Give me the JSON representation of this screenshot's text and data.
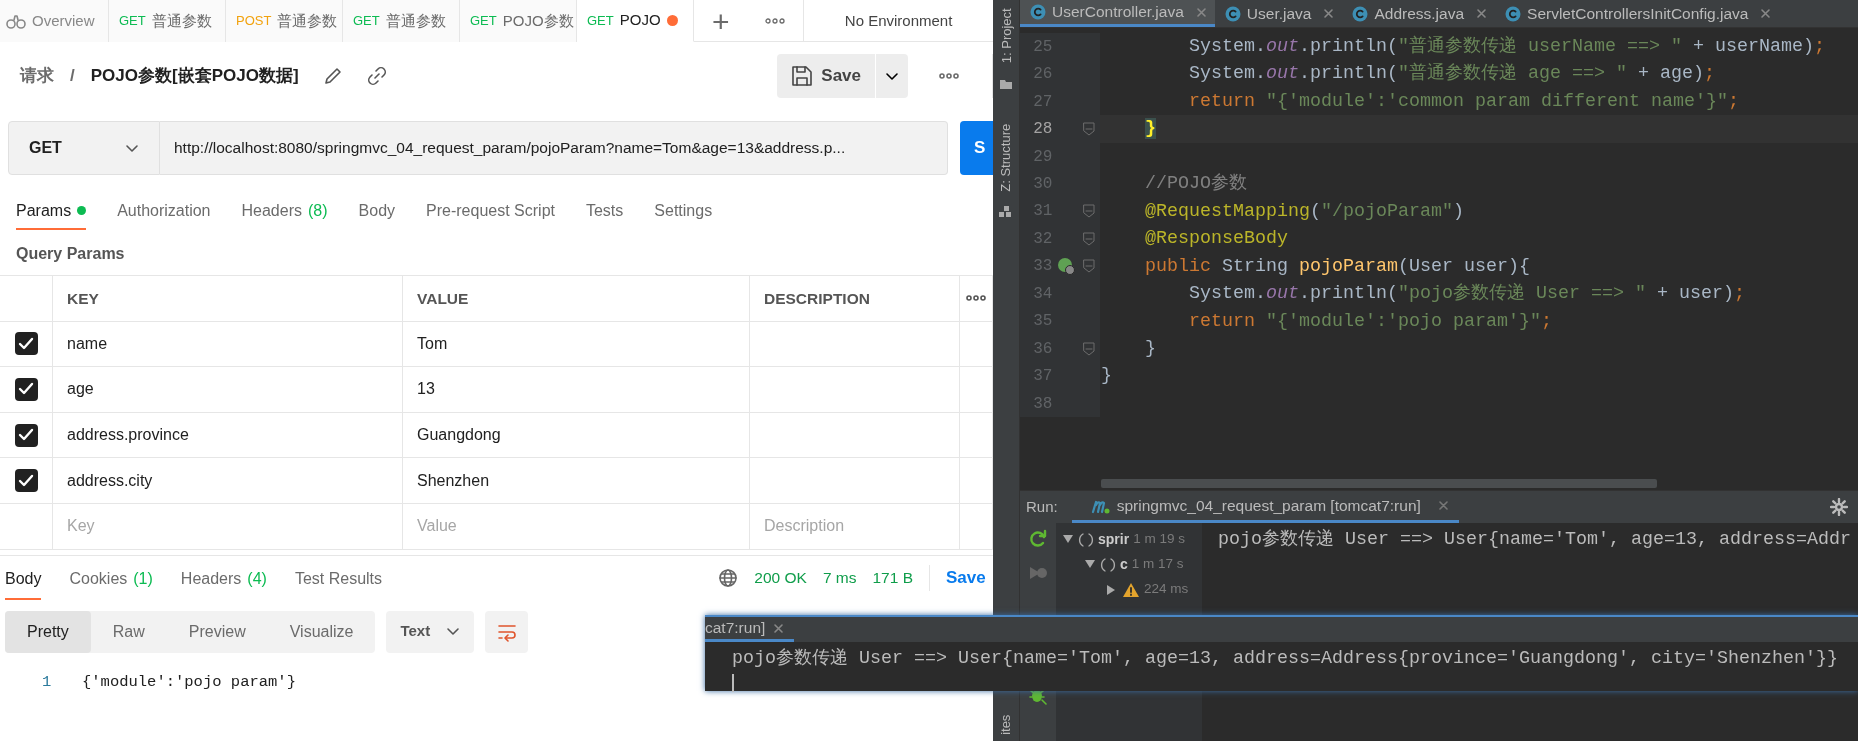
{
  "postman": {
    "tabs": [
      {
        "kind": "overview",
        "label": "Overview",
        "selected": false,
        "unsaved": false
      },
      {
        "kind": "request",
        "method": "GET",
        "label": "普通参数",
        "selected": false,
        "unsaved": false
      },
      {
        "kind": "request",
        "method": "POST",
        "label": "普通参数",
        "selected": false,
        "unsaved": false
      },
      {
        "kind": "request",
        "method": "GET",
        "label": "普通参数",
        "selected": false,
        "unsaved": false
      },
      {
        "kind": "request",
        "method": "GET",
        "label": "POJO参数",
        "selected": false,
        "unsaved": false
      },
      {
        "kind": "request",
        "method": "GET",
        "label": "POJO",
        "selected": true,
        "unsaved": true
      }
    ],
    "add_tab": "+",
    "environment": "No Environment",
    "breadcrumb": {
      "parent": "请求",
      "separator": "/",
      "title": "POJO参数[嵌套POJO数据]"
    },
    "save": "Save",
    "request": {
      "method": "GET",
      "url": "http://localhost:8080/springmvc_04_request_param/pojoParam?name=Tom&age=13&address.p...",
      "send": "S"
    },
    "request_tabs": [
      {
        "label": "Params",
        "dot": true,
        "selected": true
      },
      {
        "label": "Authorization",
        "dot": false,
        "selected": false
      },
      {
        "label": "Headers",
        "count": "(8)",
        "dot": false,
        "selected": false
      },
      {
        "label": "Body",
        "dot": false,
        "selected": false
      },
      {
        "label": "Pre-request Script",
        "dot": false,
        "selected": false
      },
      {
        "label": "Tests",
        "dot": false,
        "selected": false
      },
      {
        "label": "Settings",
        "dot": false,
        "selected": false
      }
    ],
    "query_params": {
      "title": "Query Params",
      "columns": [
        "KEY",
        "VALUE",
        "DESCRIPTION"
      ],
      "rows": [
        {
          "checked": true,
          "key": "name",
          "value": "Tom"
        },
        {
          "checked": true,
          "key": "age",
          "value": "13"
        },
        {
          "checked": true,
          "key": "address.province",
          "value": "Guangdong"
        },
        {
          "checked": true,
          "key": "address.city",
          "value": "Shenzhen"
        }
      ],
      "new_row": {
        "key": {
          "placeholder": "Key"
        },
        "value": {
          "placeholder": "Value"
        },
        "description": {
          "placeholder": "Description"
        }
      }
    },
    "response": {
      "tabs": [
        {
          "label": "Body",
          "selected": true
        },
        {
          "label": "Cookies",
          "count": "(1)",
          "selected": false
        },
        {
          "label": "Headers",
          "count": "(4)",
          "selected": false
        },
        {
          "label": "Test Results",
          "selected": false
        }
      ],
      "status": "200 OK",
      "time": "7 ms",
      "size": "171 B",
      "save": "Save",
      "views": [
        {
          "label": "Pretty",
          "selected": true
        },
        {
          "label": "Raw",
          "selected": false
        },
        {
          "label": "Preview",
          "selected": false
        },
        {
          "label": "Visualize",
          "selected": false
        }
      ],
      "format": "Text",
      "lines": [
        {
          "number": "1",
          "text": "{'module':'pojo param'}"
        }
      ]
    }
  },
  "ide": {
    "side_tools": [
      "1: Project",
      "Z: Structure"
    ],
    "side_tool_bottom": "ites",
    "file_tabs": [
      {
        "label": "UserController.java",
        "selected": true
      },
      {
        "label": "User.java",
        "selected": false
      },
      {
        "label": "Address.java",
        "selected": false
      },
      {
        "label": "ServletControllersInitConfig.java",
        "selected": false
      }
    ],
    "code": [
      {
        "number": "25",
        "current": false,
        "fold": false,
        "marker": false,
        "tokens": [
          {
            "kind": "plain",
            "text": "        System."
          },
          {
            "kind": "field",
            "text": "out"
          },
          {
            "kind": "plain",
            "text": ".println("
          },
          {
            "kind": "string",
            "text": "\"普通参数传递 userName ==> \""
          },
          {
            "kind": "plain",
            "text": " + userName)"
          },
          {
            "kind": "keyword",
            "text": ";"
          }
        ]
      },
      {
        "number": "26",
        "current": false,
        "fold": false,
        "marker": false,
        "tokens": [
          {
            "kind": "plain",
            "text": "        System."
          },
          {
            "kind": "field",
            "text": "out"
          },
          {
            "kind": "plain",
            "text": ".println("
          },
          {
            "kind": "string",
            "text": "\"普通参数传递 age ==> \""
          },
          {
            "kind": "plain",
            "text": " + age)"
          },
          {
            "kind": "keyword",
            "text": ";"
          }
        ]
      },
      {
        "number": "27",
        "current": false,
        "fold": false,
        "marker": false,
        "tokens": [
          {
            "kind": "keyword",
            "text": "        return "
          },
          {
            "kind": "string",
            "text": "\"{'module':'common param different name'}\""
          },
          {
            "kind": "keyword",
            "text": ";"
          }
        ]
      },
      {
        "number": "28",
        "current": true,
        "fold": true,
        "marker": false,
        "tokens": [
          {
            "kind": "brace",
            "text": "    }"
          }
        ]
      },
      {
        "number": "29",
        "current": false,
        "fold": false,
        "marker": false
      },
      {
        "number": "30",
        "current": false,
        "fold": false,
        "marker": false,
        "tokens": [
          {
            "kind": "comment",
            "text": "    //POJO参数"
          }
        ]
      },
      {
        "number": "31",
        "current": false,
        "fold": true,
        "marker": false,
        "tokens": [
          {
            "kind": "annotation",
            "text": "    @RequestMapping"
          },
          {
            "kind": "plain",
            "text": "("
          },
          {
            "kind": "string",
            "text": "\"/pojoParam\""
          },
          {
            "kind": "plain",
            "text": ")"
          }
        ]
      },
      {
        "number": "32",
        "current": false,
        "fold": true,
        "marker": false,
        "tokens": [
          {
            "kind": "annotation",
            "text": "    @ResponseBody"
          }
        ]
      },
      {
        "number": "33",
        "current": false,
        "fold": true,
        "marker": true,
        "tokens": [
          {
            "kind": "keyword",
            "text": "    public "
          },
          {
            "kind": "plain",
            "text": "String "
          },
          {
            "kind": "method",
            "text": "pojoParam"
          },
          {
            "kind": "plain",
            "text": "(User user){"
          }
        ]
      },
      {
        "number": "34",
        "current": false,
        "fold": false,
        "marker": false,
        "tokens": [
          {
            "kind": "plain",
            "text": "        System."
          },
          {
            "kind": "field",
            "text": "out"
          },
          {
            "kind": "plain",
            "text": ".println("
          },
          {
            "kind": "string",
            "text": "\"pojo参数传递 User ==> \""
          },
          {
            "kind": "plain",
            "text": " + user)"
          },
          {
            "kind": "keyword",
            "text": ";"
          }
        ]
      },
      {
        "number": "35",
        "current": false,
        "fold": false,
        "marker": false,
        "tokens": [
          {
            "kind": "keyword",
            "text": "        return "
          },
          {
            "kind": "string",
            "text": "\"{'module':'pojo param'}\""
          },
          {
            "kind": "keyword",
            "text": ";"
          }
        ]
      },
      {
        "number": "36",
        "current": false,
        "fold": true,
        "marker": false,
        "tokens": [
          {
            "kind": "plain",
            "text": "    }"
          }
        ]
      },
      {
        "number": "37",
        "current": false,
        "fold": false,
        "marker": false,
        "tokens": [
          {
            "kind": "plain",
            "text": "}"
          }
        ]
      },
      {
        "number": "38",
        "current": false,
        "fold": false,
        "marker": false
      }
    ],
    "run": {
      "label": "Run:",
      "title": "springmvc_04_request_param [tomcat7:run]",
      "tree": [
        {
          "name": "sprir",
          "time": "1 m 19 s",
          "expanded": true,
          "children": [
            {
              "name": "c",
              "time": "1 m 17 s",
              "expanded": true,
              "children": [
                {
                  "kind": "warning",
                  "time": "224 ms",
                  "expanded": false
                }
              ]
            }
          ]
        }
      ],
      "output": "pojo参数传递 User ==> User{name='Tom', age=13, address=Addr"
    },
    "popup": {
      "title": "cat7:run]",
      "output": "pojo参数传递 User ==> User{name='Tom', age=13, address=Address{province='Guangdong', city='Shenzhen'}}"
    }
  }
}
